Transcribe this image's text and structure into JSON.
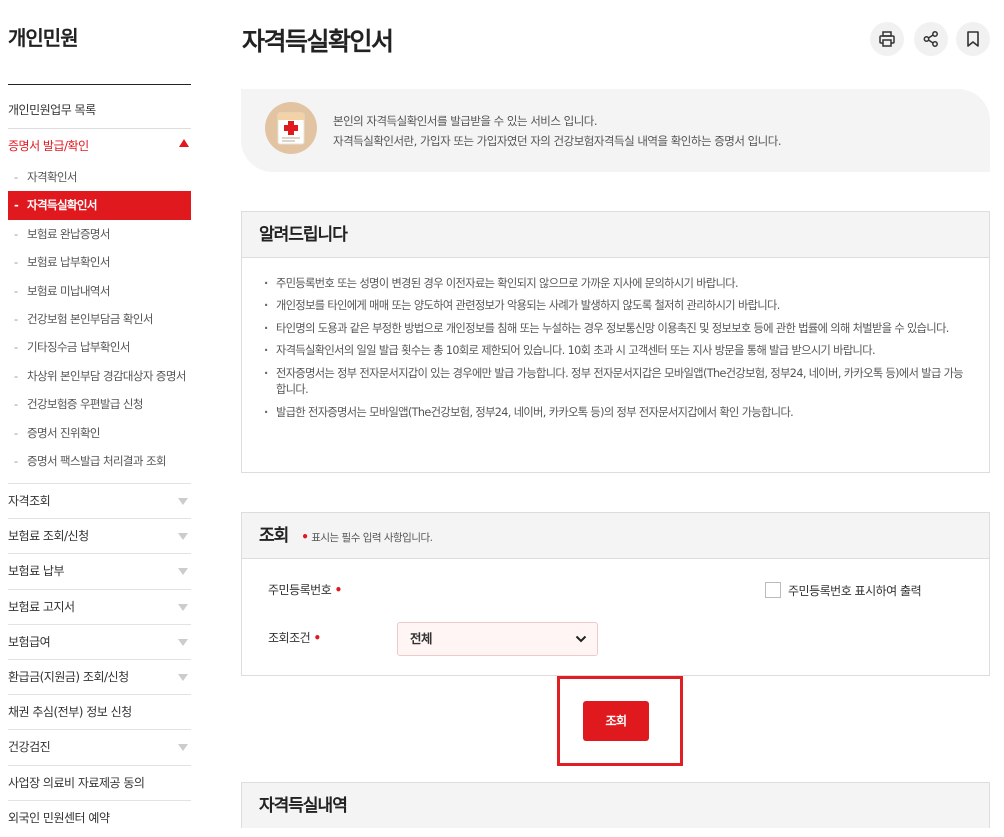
{
  "sidebar": {
    "title": "개인민원",
    "top_item": "개인민원업무 목록",
    "active_section": "증명서 발급/확인",
    "sub_items": [
      {
        "label": "자격확인서",
        "active": false
      },
      {
        "label": "자격득실확인서",
        "active": true
      },
      {
        "label": "보험료 완납증명서",
        "active": false
      },
      {
        "label": "보험료 납부확인서",
        "active": false
      },
      {
        "label": "보험료 미납내역서",
        "active": false
      },
      {
        "label": "건강보험 본인부담금 확인서",
        "active": false
      },
      {
        "label": "기타징수금 납부확인서",
        "active": false
      },
      {
        "label": "차상위 본인부담 경감대상자 증명서",
        "active": false
      },
      {
        "label": "건강보험증 우편발급 신청",
        "active": false
      },
      {
        "label": "증명서 진위확인",
        "active": false
      },
      {
        "label": "증명서 팩스발급 처리결과 조회",
        "active": false
      }
    ],
    "main_items": [
      {
        "label": "자격조회",
        "expandable": true
      },
      {
        "label": "보험료 조회/신청",
        "expandable": true
      },
      {
        "label": "보험료 납부",
        "expandable": true
      },
      {
        "label": "보험료 고지서",
        "expandable": true
      },
      {
        "label": "보험급여",
        "expandable": true
      },
      {
        "label": "환급금(지원금) 조회/신청",
        "expandable": true
      },
      {
        "label": "채권 추심(전부) 정보 신청",
        "expandable": false
      },
      {
        "label": "건강검진",
        "expandable": true
      },
      {
        "label": "사업장 의료비 자료제공 동의",
        "expandable": false
      },
      {
        "label": "외국인 민원센터 예약",
        "expandable": false
      }
    ]
  },
  "header": {
    "title": "자격득실확인서",
    "actions": [
      "print-icon",
      "share-icon",
      "bookmark-icon"
    ]
  },
  "intro": {
    "line1": "본인의 자격득실확인서를 발급받을 수 있는 서비스 입니다.",
    "line2": "자격득실확인서란, 가입자 또는 가입자였던 자의 건강보험자격득실 내역을 확인하는 증명서 입니다."
  },
  "notice": {
    "title": "알려드립니다",
    "items": [
      "주민등록번호 또는 성명이 변경된 경우 이전자료는 확인되지 않으므로 가까운 지사에 문의하시기 바랍니다.",
      "개인정보를 타인에게 매매 또는 양도하여 관련정보가 악용되는 사례가 발생하지 않도록 철저히 관리하시기 바랍니다.",
      "타인명의 도용과 같은 부정한 방법으로 개인정보를 침해 또는 누설하는 경우 정보통신망 이용촉진 및 정보보호 등에 관한 법률에 의해 처벌받을 수 있습니다.",
      "자격득실확인서의 일일 발급 횟수는 총 10회로 제한되어 있습니다. 10회 초과 시 고객센터 또는 지사 방문을 통해 발급 받으시기 바랍니다.",
      "전자증명서는 정부 전자문서지갑이 있는 경우에만 발급 가능합니다. 정부 전자문서지갑은 모바일앱(The건강보험, 정부24, 네이버, 카카오톡 등)에서 발급 가능합니다.",
      "발급한 전자증명서는 모바일앱(The건강보험, 정부24, 네이버, 카카오톡 등)의 정부 전자문서지갑에서 확인 가능합니다."
    ]
  },
  "search": {
    "title": "조회",
    "required_note": "표시는 필수 입력 사항입니다.",
    "required_mark": "•",
    "rrn_label": "주민등록번호",
    "rrn_print_checkbox_label": "주민등록번호 표시하여 출력",
    "rrn_print_checked": false,
    "condition_label": "조회조건",
    "condition_value": "전체",
    "submit_label": "조회"
  },
  "result": {
    "title": "자격득실내역"
  },
  "colors": {
    "accent": "#e0191f",
    "panel_bg": "#f4f4f4",
    "border": "#dddddd"
  }
}
